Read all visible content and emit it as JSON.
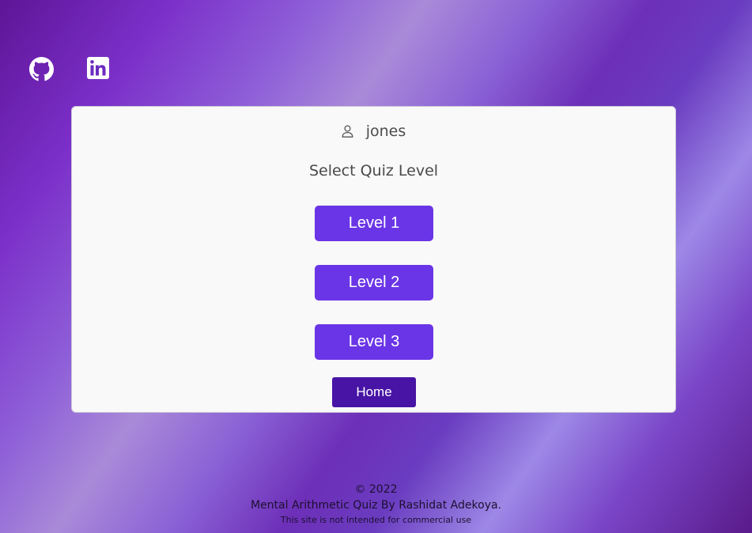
{
  "social": {
    "github_icon": "github-icon",
    "linkedin_icon": "linkedin-icon"
  },
  "card": {
    "user_icon": "person-icon",
    "username": "jones",
    "title": "Select Quiz Level",
    "levels": [
      {
        "label": "Level 1"
      },
      {
        "label": "Level 2"
      },
      {
        "label": "Level 3"
      }
    ],
    "home_label": "Home"
  },
  "footer": {
    "copyright": "© 2022",
    "credit": "Mental Arithmetic Quiz By Rashidat Adekoya.",
    "notice": "This site is not intended for commercial use"
  },
  "colors": {
    "level_button": "#6a35e6",
    "home_button": "#4714a5",
    "card_background": "#f9f9f9"
  }
}
